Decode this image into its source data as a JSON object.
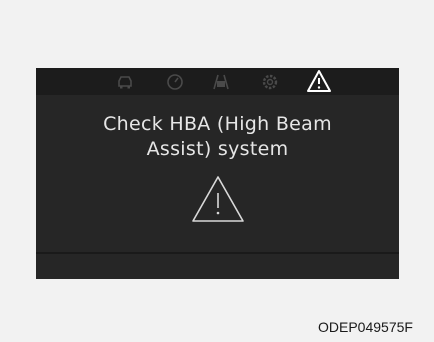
{
  "display": {
    "top_icons": [
      "car-icon",
      "gauge-icon",
      "lane-assist-icon",
      "settings-icon",
      "warning-icon"
    ],
    "active_icon": "warning-icon",
    "message_line1": "Check HBA (High Beam",
    "message_line2": "Assist) system",
    "warning_symbol": "warning-triangle-icon"
  },
  "image_code": "ODEP049575F",
  "colors": {
    "panel_background": "#262626",
    "topbar_background": "#1c1c1c",
    "dim_icon": "#4a4a4a",
    "active_icon": "#ffffff",
    "message_text": "#e6e6e6"
  }
}
